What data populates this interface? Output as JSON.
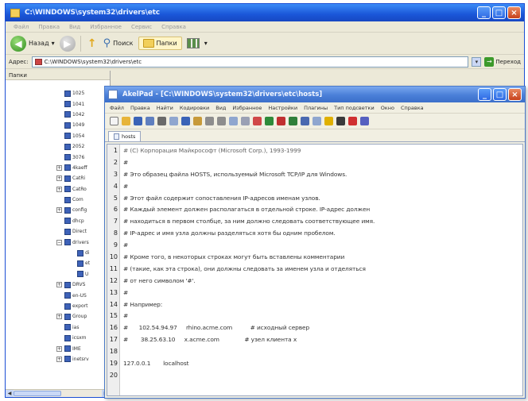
{
  "explorer": {
    "title": "C:\\WINDOWS\\system32\\drivers\\etc",
    "menu": [
      "Файл",
      "Правка",
      "Вид",
      "Избранное",
      "Сервис",
      "Справка"
    ],
    "toolbar": {
      "back_label": "Назад",
      "search_label": "Поиск",
      "folders_label": "Папки"
    },
    "address": {
      "label": "Адрес:",
      "value": "C:\\WINDOWS\\system32\\drivers\\etc",
      "go_label": "Переход"
    },
    "tree": {
      "header": "Папки",
      "items": [
        {
          "label": "1025",
          "expander": ""
        },
        {
          "label": "1041",
          "expander": ""
        },
        {
          "label": "1042",
          "expander": ""
        },
        {
          "label": "1049",
          "expander": ""
        },
        {
          "label": "1054",
          "expander": ""
        },
        {
          "label": "2052",
          "expander": ""
        },
        {
          "label": "3076",
          "expander": ""
        },
        {
          "label": "4kaeff",
          "expander": "+"
        },
        {
          "label": "CatRi",
          "expander": "+"
        },
        {
          "label": "CatRo",
          "expander": "+"
        },
        {
          "label": "Com",
          "expander": ""
        },
        {
          "label": "config",
          "expander": "+"
        },
        {
          "label": "dhcp",
          "expander": ""
        },
        {
          "label": "Direct",
          "expander": ""
        },
        {
          "label": "drivers",
          "expander": "−"
        },
        {
          "label": "di",
          "expander": "",
          "indent": true
        },
        {
          "label": "et",
          "expander": "",
          "indent": true
        },
        {
          "label": "U",
          "expander": "",
          "indent": true
        },
        {
          "label": "DRVS",
          "expander": "+"
        },
        {
          "label": "en-US",
          "expander": ""
        },
        {
          "label": "export",
          "expander": ""
        },
        {
          "label": "Group",
          "expander": "+"
        },
        {
          "label": "ias",
          "expander": ""
        },
        {
          "label": "icsxm",
          "expander": ""
        },
        {
          "label": "IME",
          "expander": "+"
        },
        {
          "label": "inetsrv",
          "expander": "+"
        }
      ]
    }
  },
  "akelpad": {
    "title": "AkelPad - [C:\\WINDOWS\\system32\\drivers\\etc\\hosts]",
    "menu": [
      "Файл",
      "Правка",
      "Найти",
      "Кодировки",
      "Вид",
      "Избранное",
      "Настройки",
      "Плагины",
      "Тип подсветки",
      "Окно",
      "Справка"
    ],
    "tab_label": "hosts",
    "lines": [
      {
        "n": "1",
        "text": "# (C) Корпорация Майкрософт (Microsoft Corp.), 1993-1999"
      },
      {
        "n": "2",
        "text": "#"
      },
      {
        "n": "3",
        "text": "# Это образец файла HOSTS, используемый Microsoft TCP/IP для Windows."
      },
      {
        "n": "4",
        "text": "#"
      },
      {
        "n": "5",
        "text": "# Этот файл содержит сопоставления IP-адресов именам узлов."
      },
      {
        "n": "6",
        "text": "# Каждый элемент должен располагаться в отдельной строке. IP-адрес должен"
      },
      {
        "n": "7",
        "text": "# находиться в первом столбце, за ним должно следовать соответствующее имя."
      },
      {
        "n": "8",
        "text": "# IP-адрес и имя узла должны разделяться хотя бы одним пробелом."
      },
      {
        "n": "9",
        "text": "#"
      },
      {
        "n": "10",
        "text": "# Кроме того, в некоторых строках могут быть вставлены комментарии"
      },
      {
        "n": "11",
        "text": "# (такие, как эта строка), они должны следовать за именем узла и отделяться"
      },
      {
        "n": "12",
        "text": "# от него символом '#'."
      },
      {
        "n": "13",
        "text": "#"
      },
      {
        "n": "14",
        "text": "# Например:"
      },
      {
        "n": "15",
        "text": "#"
      },
      {
        "n": "16",
        "text": "#      102.54.94.97     rhino.acme.com          # исходный сервер"
      },
      {
        "n": "17",
        "text": "#       38.25.63.10     x.acme.com              # узел клиента x"
      },
      {
        "n": "18",
        "text": ""
      },
      {
        "n": "19",
        "text": "127.0.0.1       localhost"
      },
      {
        "n": "20",
        "text": ""
      }
    ]
  },
  "colors": {
    "xp_title_blue": "#1a56d8",
    "akel_title_blue": "#4a7fd8",
    "window_face": "#ece9d8"
  }
}
